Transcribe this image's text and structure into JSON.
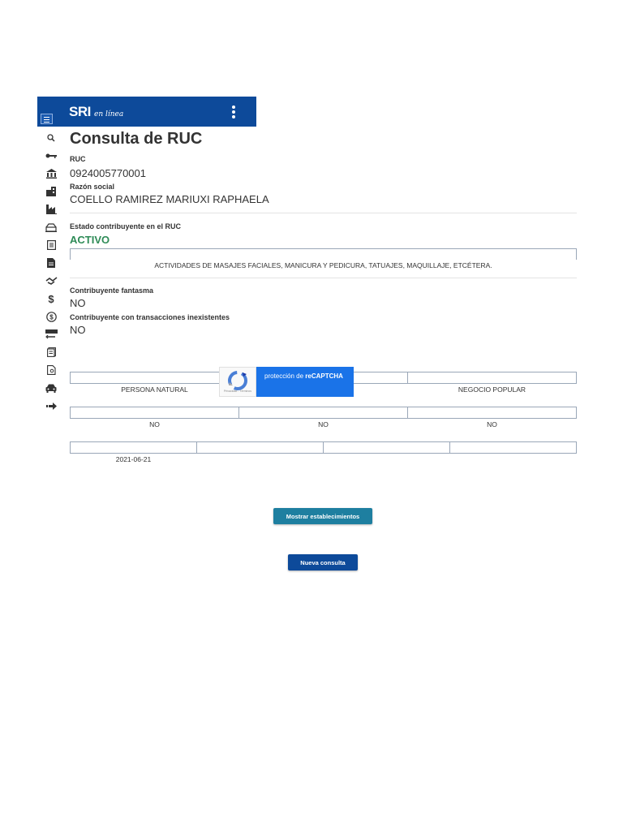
{
  "header": {
    "logo_text": "SRI",
    "logo_subtext": "en línea",
    "brand_color": "#0d4a9a"
  },
  "sidebar": {
    "icons": [
      "search-icon",
      "key-icon",
      "bank-icon",
      "buildings-icon",
      "factory-icon",
      "inbox-icon",
      "document-list-icon",
      "document-icon",
      "handshake-icon",
      "dollar-icon",
      "coin-icon",
      "money-transfer-icon",
      "forms-icon",
      "file-search-icon",
      "car-icon",
      "arrow-right-icon"
    ]
  },
  "page": {
    "title": "Consulta de RUC",
    "ruc_label": "RUC",
    "ruc_value": "0924005770001",
    "razon_label": "Razón social",
    "razon_value": "COELLO RAMIREZ MARIUXI RAPHAELA",
    "estado_label": "Estado contribuyente en el RUC",
    "estado_value": "ACTIVO",
    "estado_color": "#2e8b57",
    "actividad": "ACTIVIDADES DE MASAJES FACIALES, MANICURA Y PEDICURA, TATUAJES, MAQUILLAJE, ETCÉTERA.",
    "fantasma_label": "Contribuyente fantasma",
    "fantasma_value": "NO",
    "inexistentes_label": "Contribuyente con transacciones inexistentes",
    "inexistentes_value": "NO",
    "row1": [
      "PERSONA NATURAL",
      "",
      "NEGOCIO POPULAR"
    ],
    "row2": [
      "NO",
      "NO",
      "NO"
    ],
    "row3": [
      "2021-06-21",
      "",
      "",
      ""
    ]
  },
  "captcha": {
    "text_prefix": "protección de ",
    "text_brand": "reCAPTCHA",
    "small_text": "Privacidad - Términos"
  },
  "buttons": {
    "mostrar": "Mostrar establecimientos",
    "mostrar_color": "#1e7fa0",
    "nueva": "Nueva consulta",
    "nueva_color": "#0d4a9a"
  }
}
